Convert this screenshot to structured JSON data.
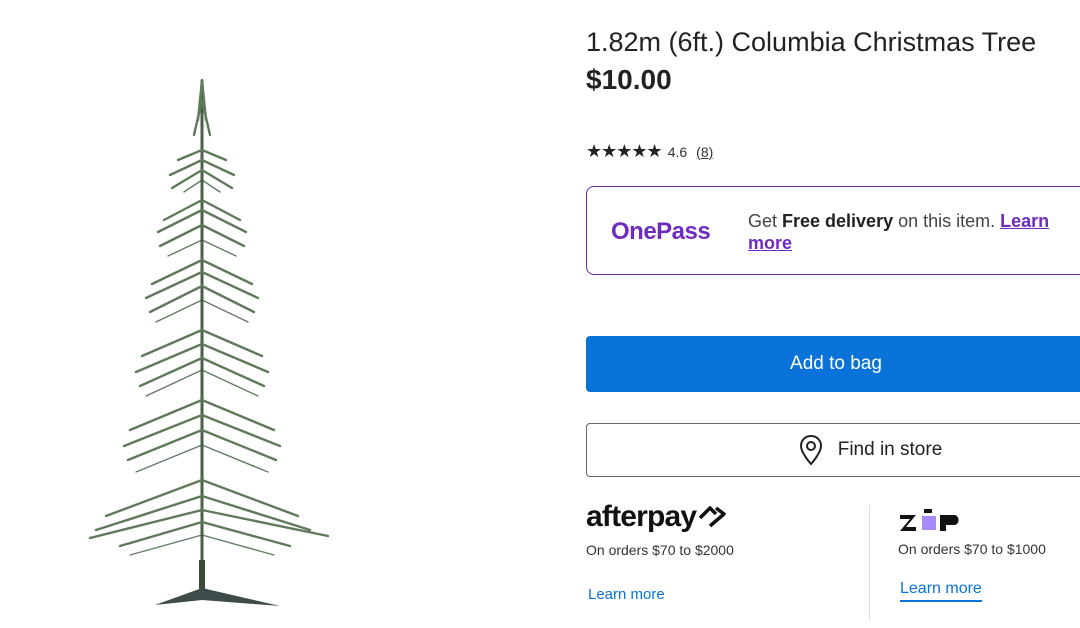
{
  "product": {
    "title": "1.82m (6ft.) Columbia Christmas Tree",
    "price": "$10.00",
    "image_alt_icon": "christmas-tree-image"
  },
  "rating": {
    "stars": "★★★★★",
    "value": "4.6",
    "reviews": "(8)"
  },
  "onepass": {
    "logo": "OnePass",
    "text_before": "Get ",
    "text_bold": "Free delivery",
    "text_after": " on this item. ",
    "link": "Learn more",
    "accent_color": "#6f2bbd"
  },
  "actions": {
    "add_to_bag": "Add to bag",
    "find_in_store": "Find in store",
    "primary_color": "#0a73d9"
  },
  "afterpay": {
    "logo": "afterpay",
    "note": "On orders $70 to $2000",
    "link": "Learn more"
  },
  "zip": {
    "logo": "zip",
    "note": "On orders $70 to $1000",
    "link": "Learn more"
  }
}
